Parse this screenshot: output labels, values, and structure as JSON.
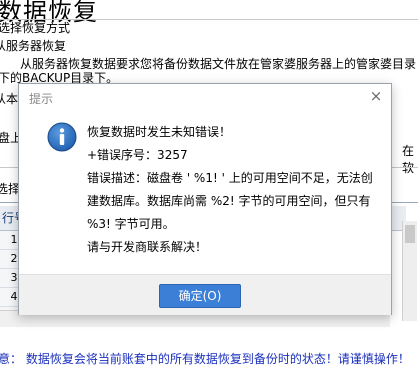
{
  "page": {
    "title": "数据恢复",
    "section_label": "选择恢复方式",
    "option_server": "从服务器恢复",
    "server_desc_line1": "从服务器恢复数据要求您将备份数据文件放在管家婆服务器上的管家婆目录",
    "server_desc_line2": "下的BACKUP目录下。",
    "option_local": "从本",
    "left_fragment": "盘上",
    "right_fragment": "在软",
    "select_label": "选择",
    "grid_header_row_num": "行号",
    "grid_rows": [
      "1",
      "2",
      "3",
      "4",
      "5"
    ],
    "bottom_note": "意：  数据恢复会将当前账套中的所有数据恢复到备份时的状态！请谨慎操作！"
  },
  "dialog": {
    "title": "提示",
    "close_glyph": "×",
    "icon": "info-icon",
    "line1": "恢复数据时发生未知错误！",
    "line2": "+错误序号：3257",
    "line3": "错误描述：磁盘卷 ' %1! ' 上的可用空间不足，无法创",
    "line4": "建数据库。数据库尚需 %2! 字节的可用空间，但只有",
    "line5": "%3! 字节可用。",
    "line6": "请与开发商联系解决！",
    "ok_label": "确定(O)"
  },
  "colors": {
    "accent": "#3c7fd6",
    "note_text": "#1a2fbb",
    "info_icon": "#1f5fae"
  }
}
